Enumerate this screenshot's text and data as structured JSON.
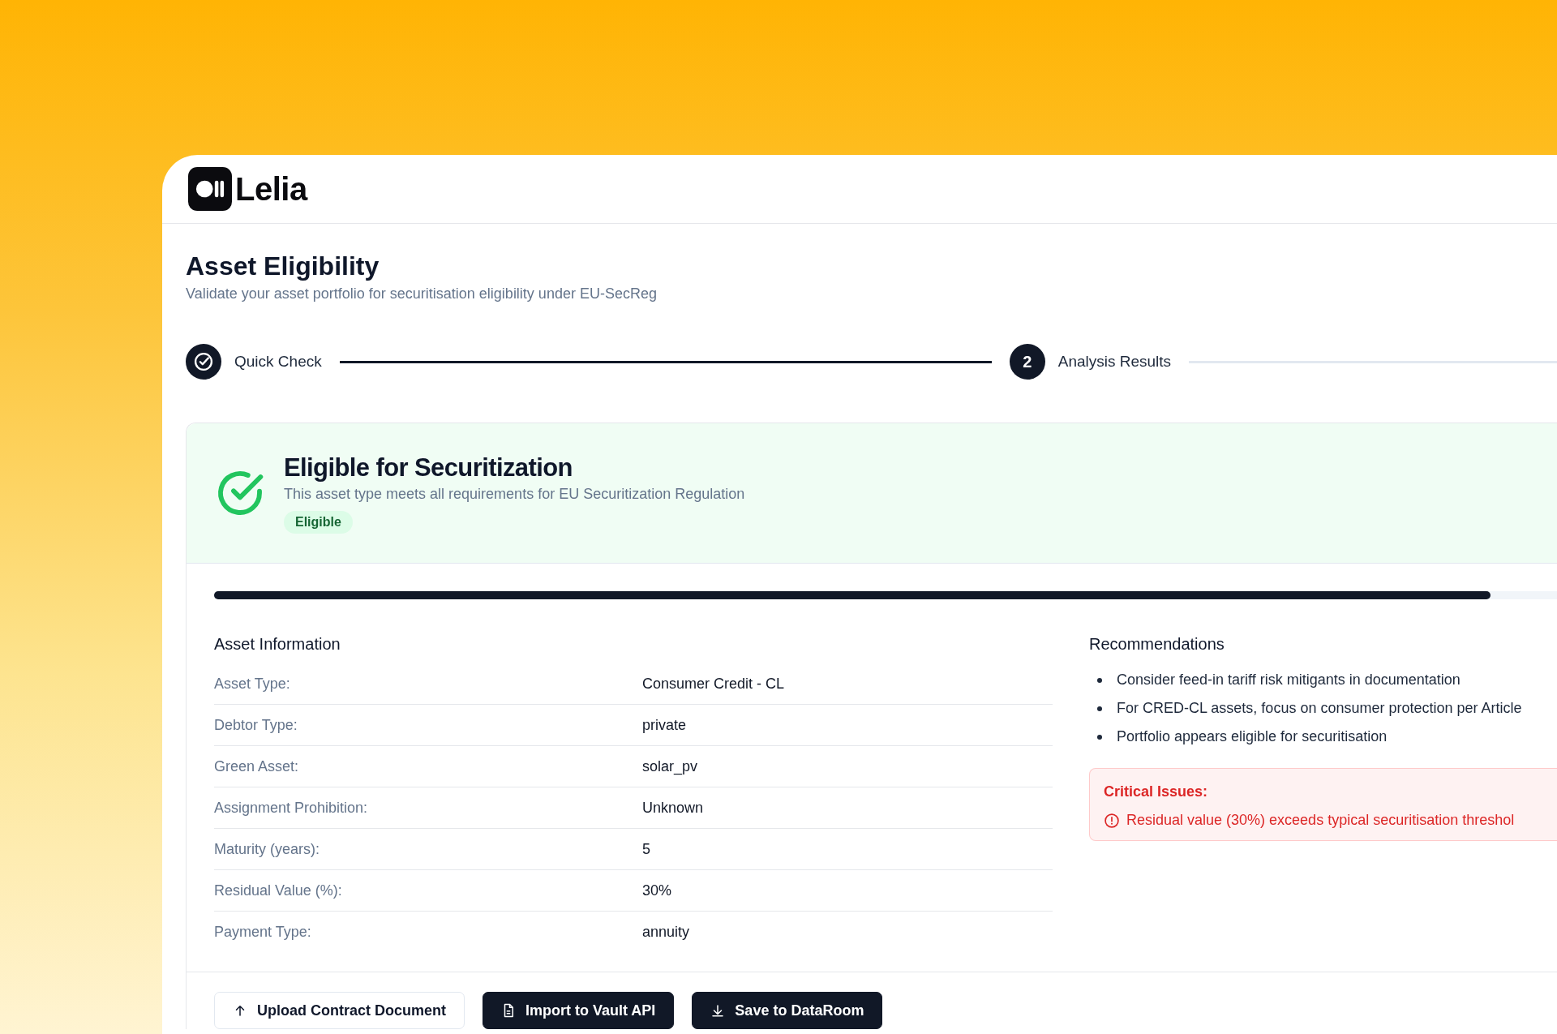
{
  "brand": {
    "name": "Lelia"
  },
  "page": {
    "title": "Asset Eligibility",
    "subtitle": "Validate your asset portfolio for securitisation eligibility under EU-SecReg"
  },
  "steps": [
    {
      "label": "Quick Check",
      "kind": "done"
    },
    {
      "label": "Analysis Results",
      "kind": "current",
      "number": "2"
    }
  ],
  "result": {
    "eligible": true,
    "title": "Eligible for Securitization",
    "subtitle": "This asset type meets all requirements for EU Securitization Regulation",
    "badge": "Eligible",
    "level": 0.95
  },
  "asset_information": {
    "title": "Asset Information",
    "rows": [
      {
        "label": "Asset Type:",
        "value": "Consumer Credit - CL"
      },
      {
        "label": "Debtor Type:",
        "value": "private"
      },
      {
        "label": "Green Asset:",
        "value": "solar_pv"
      },
      {
        "label": "Assignment Prohibition:",
        "value": "Unknown"
      },
      {
        "label": "Maturity (years):",
        "value": "5"
      },
      {
        "label": "Residual Value (%):",
        "value": "30%"
      },
      {
        "label": "Payment Type:",
        "value": "annuity"
      }
    ]
  },
  "recommendations": {
    "title": "Recommendations",
    "items": [
      "Consider feed-in tariff risk mitigants in documentation",
      "For CRED-CL assets, focus on consumer protection per Article",
      "Portfolio appears eligible for securitisation"
    ]
  },
  "critical_issues": {
    "title": "Critical Issues:",
    "items": [
      "Residual value (30%) exceeds typical securitisation threshol"
    ]
  },
  "actions": [
    {
      "label": "Upload Contract Document",
      "kind": "upload"
    },
    {
      "label": "Import to Vault API",
      "kind": "import"
    },
    {
      "label": "Save to DataRoom",
      "kind": "save"
    }
  ]
}
